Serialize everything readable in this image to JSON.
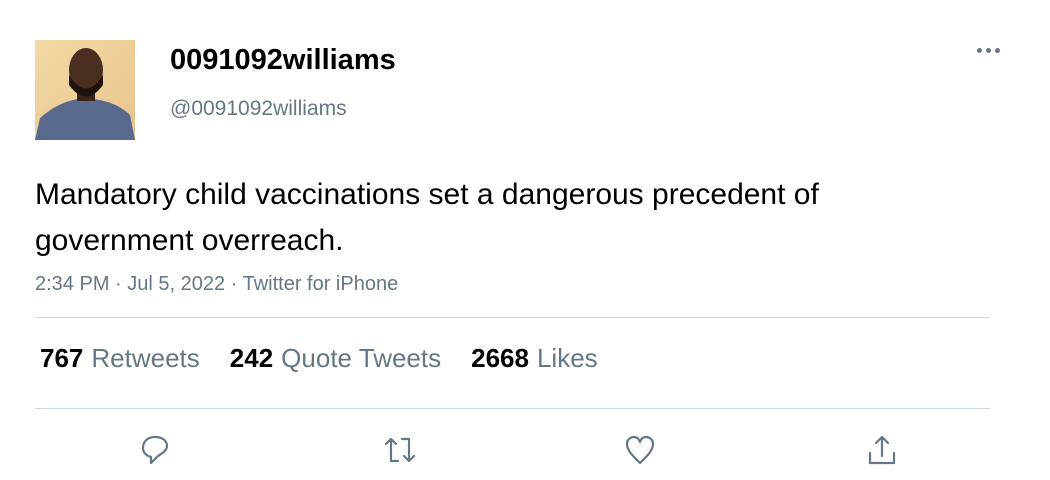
{
  "user": {
    "display_name": "0091092williams",
    "handle": "@0091092williams"
  },
  "tweet": {
    "text": "Mandatory child vaccinations set a dangerous precedent of government overreach.",
    "time": "2:34 PM",
    "date": "Jul 5, 2022",
    "source": "Twitter for iPhone",
    "separator": "·"
  },
  "stats": [
    {
      "count": "767",
      "label": "Retweets"
    },
    {
      "count": "242",
      "label": "Quote Tweets"
    },
    {
      "count": "2668",
      "label": "Likes"
    }
  ],
  "actions": [
    "reply-icon",
    "retweet-icon",
    "like-icon",
    "share-icon"
  ],
  "colors": {
    "secondary": "#657786",
    "divider": "#ccd6dd"
  }
}
